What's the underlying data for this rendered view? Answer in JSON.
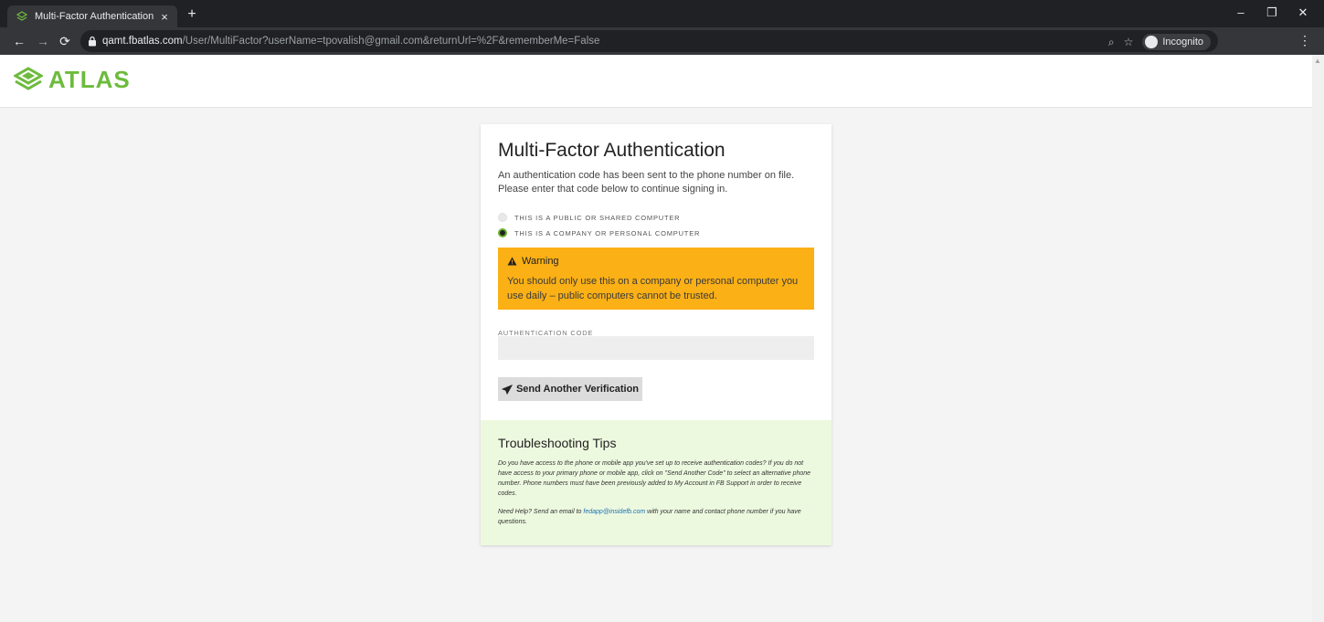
{
  "browser": {
    "tab_title": "Multi-Factor Authentication",
    "tab_close": "×",
    "new_tab": "+",
    "url_host": "qamt.fbatlas.com",
    "url_path": "/User/MultiFactor?userName=tpovalish@gmail.com&returnUrl=%2F&rememberMe=False",
    "incognito_label": "Incognito"
  },
  "header": {
    "logo_text": "ATLAS",
    "brand_color": "#6dbb3d"
  },
  "card": {
    "title": "Multi-Factor Authentication",
    "description": "An authentication code has been sent to the phone number on file. Please enter that code below to continue signing in.",
    "options": [
      {
        "label": "THIS IS A PUBLIC OR SHARED COMPUTER",
        "selected": false
      },
      {
        "label": "THIS IS A COMPANY OR PERSONAL COMPUTER",
        "selected": true
      }
    ],
    "warning": {
      "title": "Warning",
      "text": "You should only use this on a company or personal computer you use daily – public computers cannot be trusted.",
      "color": "#fbb016"
    },
    "code_label": "AUTHENTICATION CODE",
    "code_value": "",
    "send_button": "Send Another Verification"
  },
  "tips": {
    "title": "Troubleshooting Tips",
    "p1": "Do you have access to the phone or mobile app you've set up to receive authentication codes? If you do not have access to your primary phone or mobile app, click on \"Send Another Code\" to select an alternative phone number. Phone numbers must have been previously added to My Account in FB Support in order to receive codes.",
    "p2_before": "Need Help? Send an email to ",
    "p2_email": "fedapp@insidefb.com",
    "p2_after": " with your name and contact phone number if you have questions.",
    "bg_color": "#edf9df"
  }
}
